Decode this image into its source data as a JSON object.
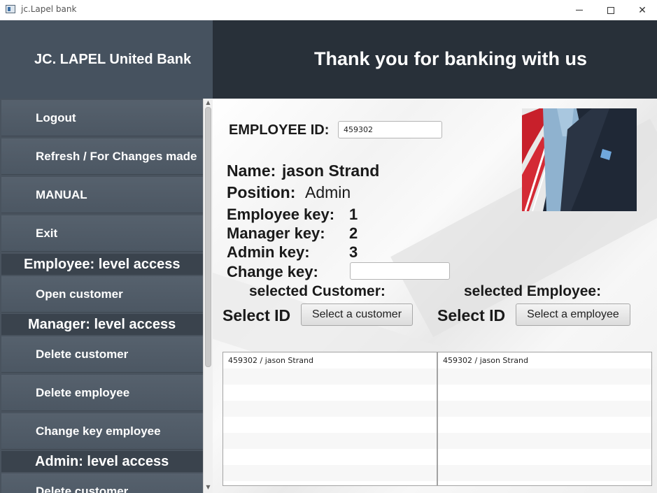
{
  "window": {
    "title": "jc.Lapel bank"
  },
  "header": {
    "brand": "JC. LAPEL United Bank",
    "banner": "Thank you for banking with us"
  },
  "sidebar": {
    "items": [
      {
        "type": "button",
        "label": "Logout"
      },
      {
        "type": "button",
        "label": "Refresh / For Changes made"
      },
      {
        "type": "button",
        "label": "MANUAL"
      },
      {
        "type": "button",
        "label": "Exit"
      },
      {
        "type": "heading",
        "label": "Employee: level access"
      },
      {
        "type": "button",
        "label": "Open customer"
      },
      {
        "type": "heading",
        "label": "Manager: level access"
      },
      {
        "type": "button",
        "label": "Delete customer"
      },
      {
        "type": "button",
        "label": "Delete employee"
      },
      {
        "type": "button",
        "label": "Change key employee"
      },
      {
        "type": "heading",
        "label": "Admin: level access"
      },
      {
        "type": "button",
        "label": "Delete customer"
      }
    ]
  },
  "main": {
    "employee_id_label": "EMPLOYEE ID:",
    "employee_id_value": "459302",
    "name_label": "Name:",
    "name_value": "jason Strand",
    "position_label": "Position:",
    "position_value": "Admin",
    "employee_key_label": "Employee key:",
    "employee_key_value": "1",
    "manager_key_label": "Manager key:",
    "manager_key_value": "2",
    "admin_key_label": "Admin key:",
    "admin_key_value": "3",
    "change_key_label": "Change key:",
    "change_key_value": "",
    "selected_customer_label": "selected Customer:",
    "selected_employee_label": "selected Employee:",
    "select_id_label": "Select ID",
    "select_customer_button": "Select a customer",
    "select_employee_button": "Select a employee",
    "customer_list": [
      "459302 / jason Strand"
    ],
    "employee_list": [
      "459302 / jason Strand"
    ]
  }
}
